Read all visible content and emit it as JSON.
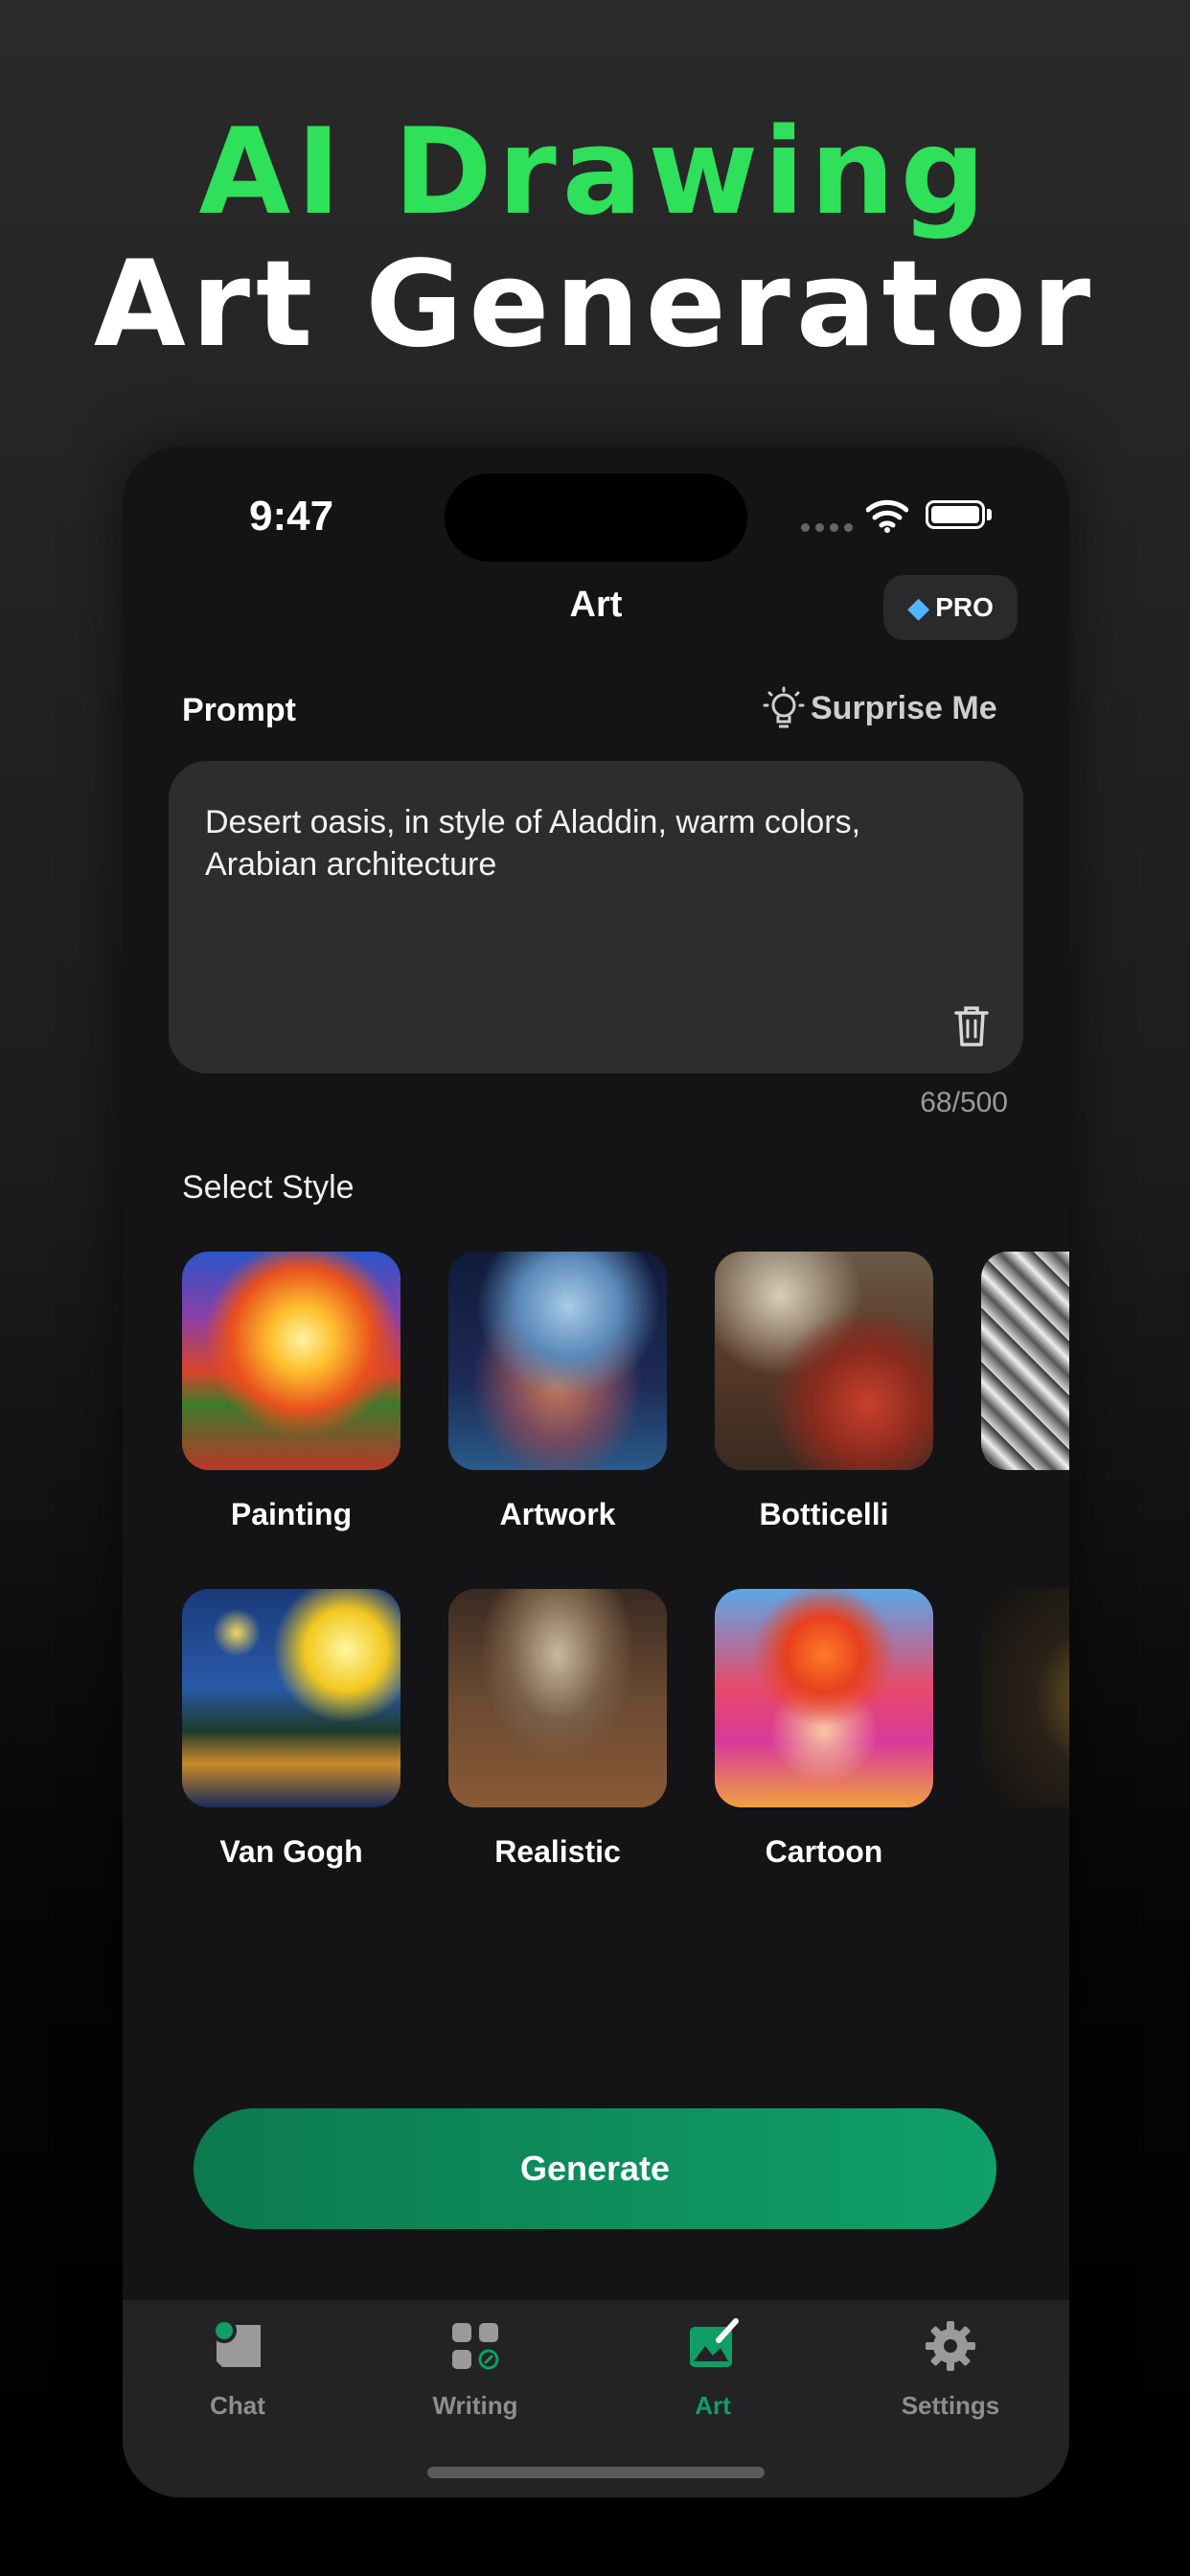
{
  "promo": {
    "line1": "AI Drawing",
    "line2": "Art Generator"
  },
  "status": {
    "time": "9:47"
  },
  "header": {
    "title": "Art",
    "pro_label": "PRO"
  },
  "prompt": {
    "label": "Prompt",
    "surprise_label": "Surprise Me",
    "text": "Desert oasis, in style of Aladdin, warm colors, Arabian architecture",
    "counter": "68/500"
  },
  "styles": {
    "label": "Select Style",
    "row1": [
      {
        "name": "Painting"
      },
      {
        "name": "Artwork"
      },
      {
        "name": "Botticelli"
      }
    ],
    "row2": [
      {
        "name": "Van Gogh"
      },
      {
        "name": "Realistic"
      },
      {
        "name": "Cartoon"
      }
    ]
  },
  "generate_label": "Generate",
  "tabs": [
    {
      "label": "Chat",
      "icon": "chat-icon"
    },
    {
      "label": "Writing",
      "icon": "writing-icon"
    },
    {
      "label": "Art",
      "icon": "art-icon",
      "active": true
    },
    {
      "label": "Settings",
      "icon": "gear-icon"
    }
  ],
  "colors": {
    "accent": "#2ee05a",
    "button": "#0f8f5c",
    "active_tab": "#109e66"
  }
}
